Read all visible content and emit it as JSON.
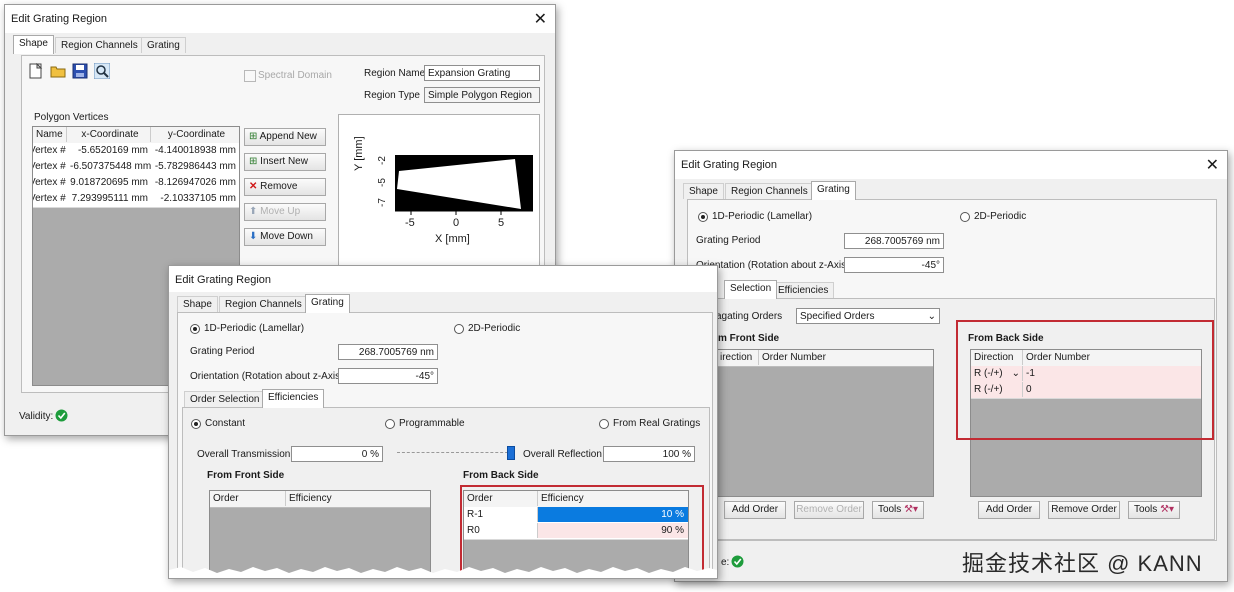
{
  "dialog_a": {
    "title": "Edit Grating Region",
    "tabs": [
      "Shape",
      "Region Channels",
      "Grating"
    ],
    "spectral_domain": "Spectral Domain",
    "region_name_label": "Region Name",
    "region_name_value": "Expansion Grating",
    "region_type_label": "Region Type",
    "region_type_value": "Simple Polygon Region",
    "vertices_title": "Polygon Vertices",
    "columns": [
      "Name",
      "x-Coordinate",
      "y-Coordinate"
    ],
    "rows": [
      [
        "Vertex #",
        "-5.6520169 mm",
        "-4.140018938 mm"
      ],
      [
        "Vertex #",
        "-6.507375448 mm",
        "-5.782986443 mm"
      ],
      [
        "Vertex #",
        "9.018720695 mm",
        "-8.126947026 mm"
      ],
      [
        "Vertex #",
        "7.293995111 mm",
        "-2.10337105 mm"
      ]
    ],
    "buttons": {
      "append": "Append New",
      "insert": "Insert New",
      "remove": "Remove",
      "move_up": "Move Up",
      "move_down": "Move Down"
    },
    "plot": {
      "y_label": "Y [mm]",
      "x_label": "X [mm]",
      "x_ticks": [
        "-5",
        "0",
        "5"
      ],
      "y_ticks": [
        "-2",
        "-5",
        "-7"
      ]
    },
    "validity": "Validity:"
  },
  "dialog_b": {
    "title": "Edit Grating Region",
    "tabs": [
      "Shape",
      "Region Channels",
      "Grating"
    ],
    "periodic_1d": "1D-Periodic (Lamellar)",
    "periodic_2d": "2D-Periodic",
    "grating_period_label": "Grating Period",
    "grating_period_value": "268.7005769 nm",
    "orientation_label": "Orientation (Rotation about z-Axis)",
    "orientation_value": "-45°",
    "subtabs": [
      "Order Selection",
      "Efficiencies"
    ],
    "mode_constant": "Constant",
    "mode_programmable": "Programmable",
    "mode_real": "From Real Gratings",
    "overall_transmission_label": "Overall Transmission",
    "overall_transmission_value": "0 %",
    "overall_reflection_label": "Overall Reflection",
    "overall_reflection_value": "100 %",
    "slider_level": 1.0,
    "front_title": "From Front Side",
    "front_columns": [
      "Order",
      "Efficiency"
    ],
    "back_title": "From Back Side",
    "back_columns": [
      "Order",
      "Efficiency"
    ],
    "back_rows": [
      [
        "R-1",
        "10 %"
      ],
      [
        "R0",
        "90 %"
      ]
    ]
  },
  "dialog_c": {
    "title": "Edit Grating Region",
    "tabs": [
      "Shape",
      "Region Channels",
      "Grating"
    ],
    "periodic_1d": "1D-Periodic (Lamellar)",
    "periodic_2d": "2D-Periodic",
    "grating_period_label": "Grating Period",
    "grating_period_value": "268.7005769 nm",
    "orientation_label": "Orientation (Rotation about z-Axis)",
    "orientation_value": "-45°",
    "subtabs": [
      "Selection",
      "Efficiencies"
    ],
    "propagating_label": "agating Orders",
    "propagating_value": "Specified Orders",
    "front_title": "m Front Side",
    "front_columns": [
      "irection",
      "Order Number"
    ],
    "back_title": "From Back Side",
    "back_columns": [
      "Direction",
      "Order Number"
    ],
    "back_rows": [
      [
        "R (-/+)",
        "-1"
      ],
      [
        "R (-/+)",
        "0"
      ]
    ],
    "add_order": "Add Order",
    "remove_order": "Remove Order",
    "tools": "Tools",
    "validity_fragment": "e:"
  },
  "watermark": "掘金技术社区 @ KANN",
  "colors": {
    "highlight_red": "#c22b33",
    "selection_blue": "#0a7be0",
    "valid_green": "#1e9c3c"
  }
}
